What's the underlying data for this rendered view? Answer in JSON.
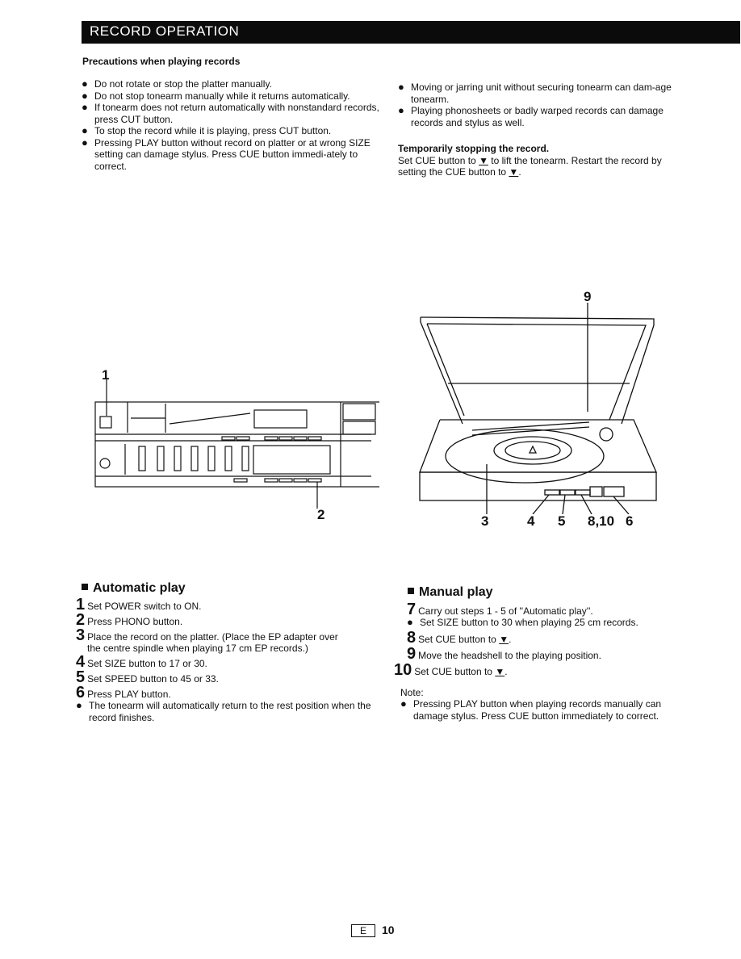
{
  "header": {
    "title": "RECORD OPERATION"
  },
  "precautions": {
    "title": "Precautions when playing records",
    "left_items": [
      "Do not rotate or stop the platter manually.",
      "Do not stop tonearm manually while it returns automatically.",
      "If tonearm does not return automatically with nonstandard records, press CUT button.",
      "To stop the record while it is playing, press CUT button.",
      "Pressing PLAY button without record on platter or at wrong SIZE setting can damage stylus. Press CUE button immedi-ately to correct."
    ],
    "right_items": [
      "Moving or jarring unit without securing tonearm can dam-age tonearm.",
      "Playing phonosheets or badly warped records can damage records and stylus as well."
    ],
    "bullet_symbol": "●"
  },
  "temporary_stop": {
    "title": "Temporarily stopping the record.",
    "text_a": "Set CUE button to ",
    "text_b": " to lift the tonearm. Restart the record by setting the CUE button to ",
    "text_c": ".",
    "cue_symbol": "▼"
  },
  "figures": {
    "amplifier_callouts": [
      "1",
      "2"
    ],
    "turntable_callouts": [
      "9",
      "3",
      "4",
      "5",
      "8,10",
      "6"
    ]
  },
  "automatic_play": {
    "title": "Automatic play",
    "steps": [
      {
        "num": "1",
        "text": "Set POWER switch to ON."
      },
      {
        "num": "2",
        "text": "Press PHONO button."
      },
      {
        "num": "3",
        "text": "Place the record on the platter. (Place the EP adapter over",
        "text2": "the centre spindle when playing 17 cm EP records.)"
      },
      {
        "num": "4",
        "text": "Set SIZE button to 17 or 30."
      },
      {
        "num": "5",
        "text": "Set SPEED button to 45 or 33."
      },
      {
        "num": "6",
        "text": "Press PLAY button."
      }
    ],
    "note": "The tonearm will automatically return to the rest position when the record finishes."
  },
  "manual_play": {
    "title": "Manual play",
    "step7": {
      "num": "7",
      "text": "Carry out steps 1 - 5 of ''Automatic play''."
    },
    "step7_note": "Set SIZE button to 30 when playing 25 cm records.",
    "step8": {
      "num": "8",
      "text": "Set CUE button to ",
      "symbol": "▼",
      "end": "."
    },
    "step9": {
      "num": "9",
      "text": "Move the headshell to the playing position."
    },
    "step10": {
      "num": "10",
      "text": "Set CUE button to ",
      "symbol": "▼",
      "end": "."
    },
    "note_label": "Note:",
    "note": "Pressing PLAY button when playing records manually can damage stylus. Press CUE button immediately to correct."
  },
  "footer": {
    "lang": "E",
    "page": "10"
  }
}
